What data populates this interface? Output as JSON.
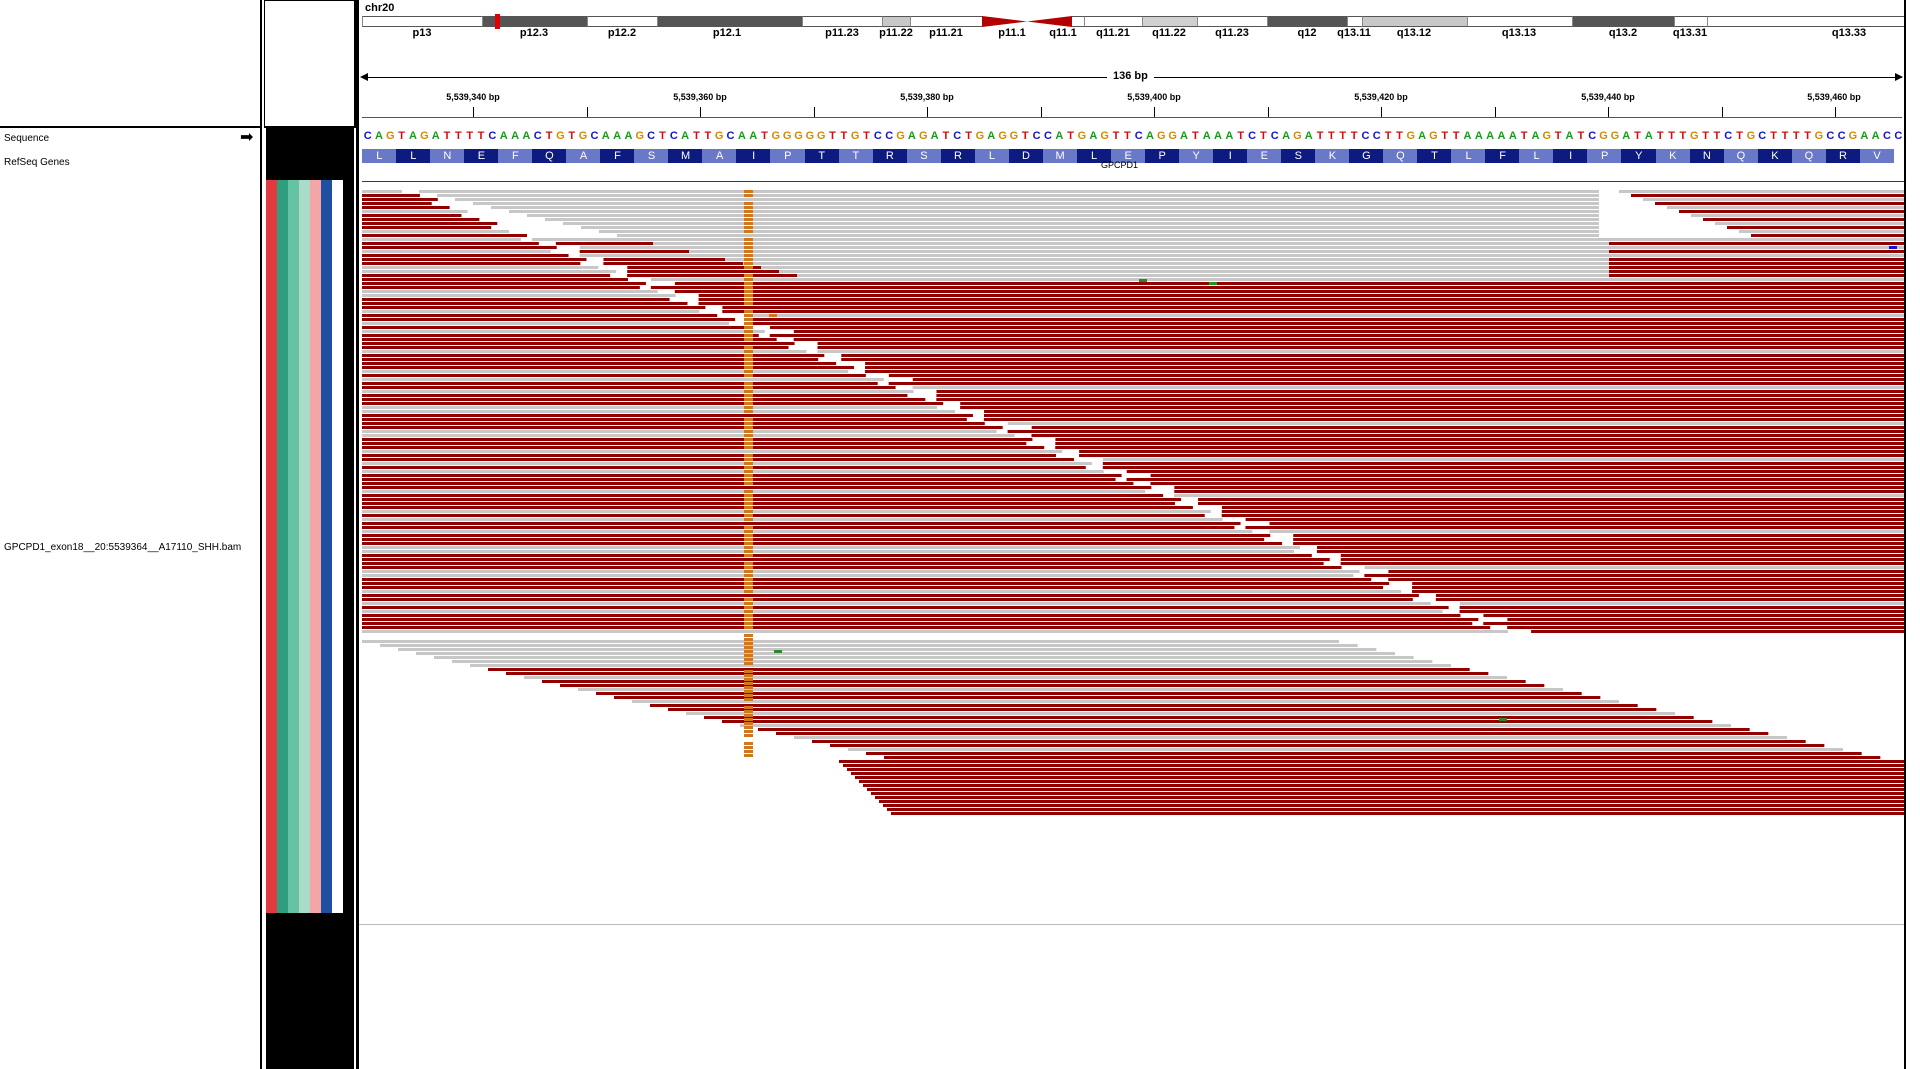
{
  "name_panel": {
    "tracks": [
      {
        "name": "Sequence",
        "top": 0
      },
      {
        "name": "RefSeq Genes",
        "top": 0
      },
      {
        "name": "GPCPD1_exon18__20:5539364__A17110_SHH.bam",
        "top": 0
      }
    ],
    "sequence_arrow": "➡"
  },
  "attributes": {
    "colors": [
      "#e03a3e",
      "#2e9e7e",
      "#66c2a5",
      "#a8dcc8",
      "#f4a6a6",
      "#1f4fa0",
      "#ffffff"
    ]
  },
  "header": {
    "chromosome": "chr20",
    "span_label": "136 bp",
    "bands": [
      {
        "label": "p13",
        "color": "#ffffff"
      },
      {
        "label": "p12.3",
        "color": "#555555"
      },
      {
        "label": "p12.2",
        "color": "#ffffff"
      },
      {
        "label": "p12.1",
        "color": "#555555"
      },
      {
        "label": "p11.23",
        "color": "#ffffff"
      },
      {
        "label": "p11.22",
        "color": "#c8c8c8"
      },
      {
        "label": "p11.21",
        "color": "#ffffff"
      },
      {
        "label": "p11.1",
        "color": "#ffffff"
      },
      {
        "label": "q11.1",
        "color": "#ffffff"
      },
      {
        "label": "q11.21",
        "color": "#ffffff"
      },
      {
        "label": "q11.22",
        "color": "#d0d0d0"
      },
      {
        "label": "q11.23",
        "color": "#ffffff"
      },
      {
        "label": "q12",
        "color": "#555555"
      },
      {
        "label": "q13.11",
        "color": "#ffffff"
      },
      {
        "label": "q13.12",
        "color": "#c8c8c8"
      },
      {
        "label": "q13.13",
        "color": "#ffffff"
      },
      {
        "label": "q13.2",
        "color": "#555555"
      },
      {
        "label": "q13.31",
        "color": "#ffffff"
      },
      {
        "label": "q13.33",
        "color": "#ffffff"
      }
    ],
    "ticks": [
      "5,539,340 bp",
      "5,539,360 bp",
      "5,539,380 bp",
      "5,539,400 bp",
      "5,539,420 bp",
      "5,539,440 bp",
      "5,539,460 bp"
    ]
  },
  "sequence": {
    "bases": "CAGTAGATTTTCAAACTGTGCAAAGCTCATTGCAATGGGGGTTGTCCGAGATCTGAGGTCCATGAGTTCAGGATAAATCTCAGATTTTCCTTGAGTTAAAAATAGTATCGGATATTTGTTCTGCTTTTGCCGAACC",
    "colors": {
      "A": "#1a9a1a",
      "C": "#1515c8",
      "G": "#d18c00",
      "T": "#d01010"
    }
  },
  "refseq": {
    "gene": "GPCPD1",
    "amino_acids": [
      "L",
      "L",
      "N",
      "E",
      "F",
      "Q",
      "A",
      "F",
      "S",
      "M",
      "A",
      "I",
      "P",
      "T",
      "T",
      "R",
      "S",
      "R",
      "L",
      "D",
      "M",
      "L",
      "E",
      "P",
      "Y",
      "I",
      "E",
      "S",
      "K",
      "G",
      "Q",
      "T",
      "L",
      "F",
      "L",
      "I",
      "P",
      "Y",
      "K",
      "N",
      "Q",
      "K",
      "Q",
      "R",
      "V"
    ],
    "dark_color": "#0d1a80",
    "light_color": "#6a78c8"
  },
  "alignment": {
    "read_red": "#930000",
    "read_grey": "#c7c7c7",
    "mismatch_orange": "#d2771b"
  }
}
